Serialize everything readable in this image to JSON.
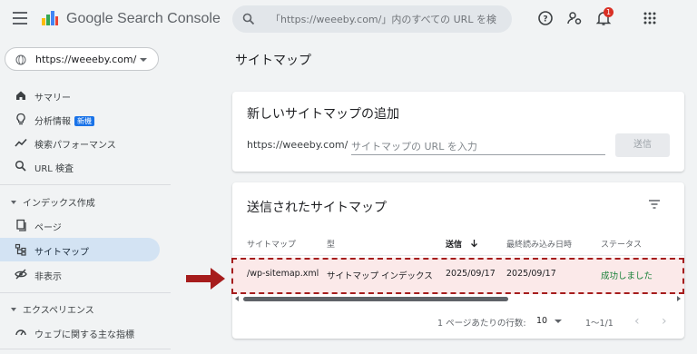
{
  "app": {
    "title": "Google Search Console"
  },
  "search": {
    "placeholder": "「https://weeeby.com/」内のすべての URL を検"
  },
  "notifications": {
    "count": "1"
  },
  "property": {
    "selected": "https://weeeby.com/"
  },
  "sidebar": {
    "items": [
      {
        "label": "サマリー",
        "icon": "home-icon"
      },
      {
        "label": "分析情報",
        "badge": "新機",
        "icon": "lightbulb-icon"
      },
      {
        "label": "検索パフォーマンス",
        "icon": "trending-icon"
      },
      {
        "label": "URL 検査",
        "icon": "search-icon"
      }
    ],
    "section_index": "インデックス作成",
    "index_items": [
      {
        "label": "ページ",
        "icon": "pages-icon"
      },
      {
        "label": "サイトマップ",
        "icon": "sitemap-icon",
        "active": true
      },
      {
        "label": "非表示",
        "icon": "eye-off-icon"
      }
    ],
    "section_experience": "エクスペリエンス",
    "experience_items": [
      {
        "label": "ウェブに関する主な指標",
        "icon": "speed-icon"
      }
    ]
  },
  "page": {
    "title": "サイトマップ"
  },
  "add_card": {
    "title": "新しいサイトマップの追加",
    "prefix": "https://weeeby.com/",
    "input_placeholder": "サイトマップの URL を入力",
    "submit_label": "送信"
  },
  "submitted_card": {
    "title": "送信されたサイトマップ",
    "headers": [
      "サイトマップ",
      "型",
      "送信",
      "最終読み込み日時",
      "ステータス"
    ],
    "rows": [
      {
        "sitemap": "/wp-sitemap.xml",
        "type": "サイトマップ インデックス",
        "submitted": "2025/09/17",
        "last_read": "2025/09/17",
        "status": "成功しました"
      }
    ],
    "pagination": {
      "rows_per_page_label": "1 ページあたりの行数:",
      "rows_per_page": "10",
      "range": "1〜1/1"
    }
  },
  "colors": {
    "accent": "#1a73e8",
    "active_nav": "#d3e3f3",
    "success": "#188038",
    "highlight_border": "#a61c1c",
    "arrow": "#a61c1c"
  }
}
